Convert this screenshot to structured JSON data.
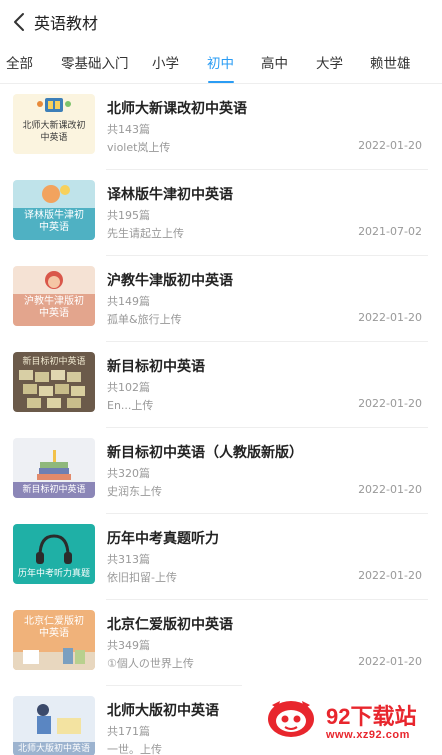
{
  "header": {
    "title": "英语教材",
    "back_icon": "chevron-left-icon"
  },
  "tabs": [
    {
      "label": "全部"
    },
    {
      "label": "零基础入门"
    },
    {
      "label": "小学"
    },
    {
      "label": "初中"
    },
    {
      "label": "高中"
    },
    {
      "label": "大学"
    },
    {
      "label": "赖世雄"
    }
  ],
  "active_tab": "初中",
  "colors": {
    "accent": "#2a9cf4",
    "watermark": "#e8262d"
  },
  "books": [
    {
      "title": "北师大新课改初中英语",
      "count": "共143篇",
      "uploader": "violet岚上传",
      "date": "2022-01-20",
      "cover_text": "北师大新课改初中英语"
    },
    {
      "title": "译林版牛津初中英语",
      "count": "共195篇",
      "uploader": "先生请起立上传",
      "date": "2021-07-02",
      "cover_text": "译林版牛津初中英语"
    },
    {
      "title": "沪教牛津版初中英语",
      "count": "共149篇",
      "uploader": "孤单&旅行上传",
      "date": "2022-01-20",
      "cover_text": "沪教牛津版初中英语"
    },
    {
      "title": "新目标初中英语",
      "count": "共102篇",
      "uploader": "En...上传",
      "date": "2022-01-20",
      "cover_text": "新目标初中英语"
    },
    {
      "title": "新目标初中英语（人教版新版）",
      "count": "共320篇",
      "uploader": "史润东上传",
      "date": "2022-01-20",
      "cover_text": "新目标初中英语"
    },
    {
      "title": "历年中考真题听力",
      "count": "共313篇",
      "uploader": "依旧扣留-上传",
      "date": "2022-01-20",
      "cover_text": "历年中考听力真题"
    },
    {
      "title": "北京仁爱版初中英语",
      "count": "共349篇",
      "uploader": "①個人の世界上传",
      "date": "2022-01-20",
      "cover_text": "北京仁爱版初中英语"
    },
    {
      "title": "北师大版初中英语",
      "count": "共171篇",
      "uploader": "一世。上传",
      "date": "",
      "cover_text": "北师大版初中英语"
    }
  ],
  "watermark": {
    "main": "92下载站",
    "url": "www.xz92.com"
  }
}
